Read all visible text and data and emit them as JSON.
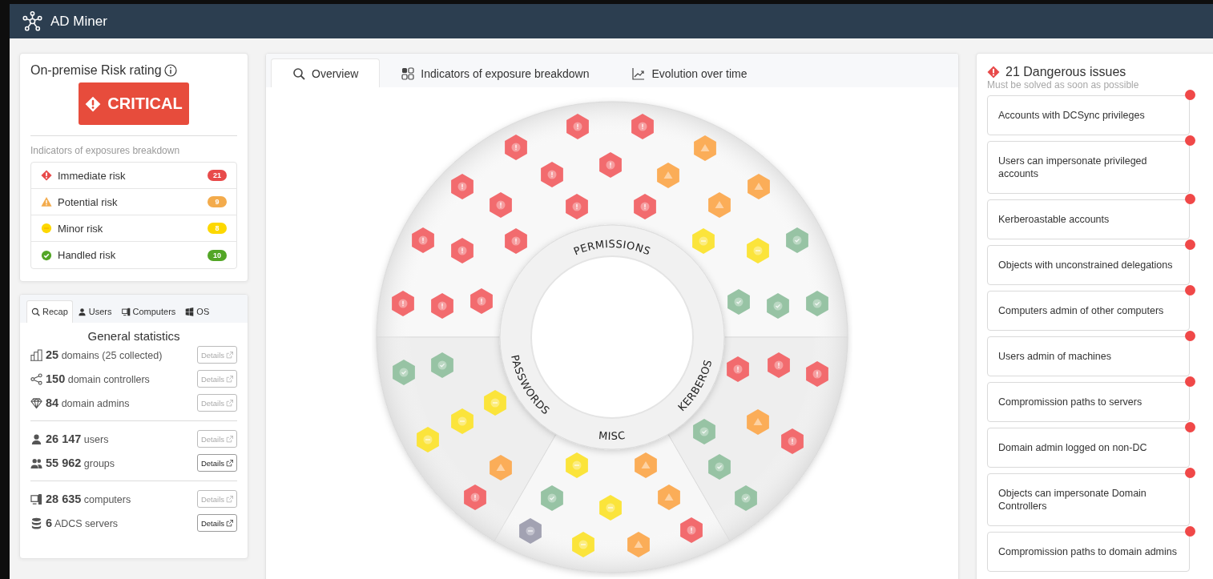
{
  "app": {
    "title": "AD Miner"
  },
  "risk_rating": {
    "title": "On-premise Risk rating",
    "rating": "CRITICAL"
  },
  "breakdown": {
    "title": "Indicators of exposures breakdown",
    "items": [
      {
        "kind": "immediate",
        "label": "Immediate risk",
        "count": "21",
        "color": "#e84a4a"
      },
      {
        "kind": "potential",
        "label": "Potential risk",
        "count": "9",
        "color": "#f3ab4c"
      },
      {
        "kind": "minor",
        "label": "Minor risk",
        "count": "8",
        "color": "#fdd800"
      },
      {
        "kind": "handled",
        "label": "Handled risk",
        "count": "10",
        "color": "#53a626"
      }
    ]
  },
  "stats_tabs": [
    {
      "kind": "search",
      "label": "Recap",
      "selected": true
    },
    {
      "kind": "user",
      "label": "Users",
      "selected": false
    },
    {
      "kind": "computer",
      "label": "Computers",
      "selected": false
    },
    {
      "kind": "windows",
      "label": "OS",
      "selected": false
    }
  ],
  "stats": {
    "title": "General statistics",
    "groups": [
      [
        {
          "kind": "building",
          "number": "25",
          "label": "domains (25 collected)",
          "details": {
            "label": "Details",
            "disabled": true
          }
        },
        {
          "kind": "share",
          "number": "150",
          "label": "domain controllers",
          "details": {
            "label": "Details",
            "disabled": true
          }
        },
        {
          "kind": "gem",
          "number": "84",
          "label": "domain admins",
          "details": {
            "label": "Details",
            "disabled": true
          }
        }
      ],
      [
        {
          "kind": "user",
          "number": "26 147",
          "label": "users",
          "details": {
            "label": "Details",
            "disabled": true
          }
        },
        {
          "kind": "users",
          "number": "55 962",
          "label": "groups",
          "details": {
            "label": "Details",
            "disabled": false
          }
        }
      ],
      [
        {
          "kind": "computer",
          "number": "28 635",
          "label": "computers",
          "details": {
            "label": "Details",
            "disabled": true
          }
        },
        {
          "kind": "database",
          "number": "6",
          "label": "ADCS servers",
          "details": {
            "label": "Details",
            "disabled": false
          }
        }
      ]
    ]
  },
  "main_tabs": [
    {
      "kind": "search",
      "label": "Overview",
      "selected": true
    },
    {
      "kind": "grid",
      "label": "Indicators of exposure breakdown",
      "selected": false
    },
    {
      "kind": "chart",
      "label": "Evolution over time",
      "selected": false
    }
  ],
  "diagram": {
    "sections": [
      {
        "label": "PERMISSIONS",
        "hexes": [
          {
            "kind": "immediate"
          },
          {
            "kind": "immediate"
          },
          {
            "kind": "immediate"
          },
          {
            "kind": "immediate"
          },
          {
            "kind": "immediate"
          },
          {
            "kind": "immediate"
          },
          {
            "kind": "immediate"
          },
          {
            "kind": "immediate"
          },
          {
            "kind": "immediate"
          },
          {
            "kind": "immediate"
          },
          {
            "kind": "immediate"
          },
          {
            "kind": "immediate"
          },
          {
            "kind": "immediate"
          },
          {
            "kind": "immediate"
          },
          {
            "kind": "immediate"
          },
          {
            "kind": "potential"
          },
          {
            "kind": "potential"
          },
          {
            "kind": "potential"
          },
          {
            "kind": "potential"
          },
          {
            "kind": "minor"
          },
          {
            "kind": "minor"
          },
          {
            "kind": "handled"
          },
          {
            "kind": "handled"
          },
          {
            "kind": "handled"
          },
          {
            "kind": "handled"
          }
        ]
      },
      {
        "label": "PASSWORDS",
        "hexes": [
          {
            "kind": "handled"
          },
          {
            "kind": "handled"
          },
          {
            "kind": "minor"
          },
          {
            "kind": "minor"
          },
          {
            "kind": "minor"
          },
          {
            "kind": "potential"
          },
          {
            "kind": "immediate"
          }
        ]
      },
      {
        "label": "MISC",
        "hexes": [
          {
            "kind": "minor"
          },
          {
            "kind": "potential"
          },
          {
            "kind": "handled"
          },
          {
            "kind": "minor"
          },
          {
            "kind": "potential"
          },
          {
            "kind": "none"
          },
          {
            "kind": "minor"
          },
          {
            "kind": "potential"
          },
          {
            "kind": "immediate"
          }
        ]
      },
      {
        "label": "KERBEROS",
        "hexes": [
          {
            "kind": "immediate"
          },
          {
            "kind": "immediate"
          },
          {
            "kind": "immediate"
          },
          {
            "kind": "potential"
          },
          {
            "kind": "handled"
          },
          {
            "kind": "immediate"
          },
          {
            "kind": "handled"
          },
          {
            "kind": "handled"
          }
        ]
      }
    ]
  },
  "issues": {
    "title": "21 Dangerous issues",
    "subtitle": "Must be solved as soon as possible",
    "items": [
      {
        "label": "Accounts with DCSync privileges"
      },
      {
        "label": "Users can impersonate privileged accounts"
      },
      {
        "label": "Kerberoastable accounts"
      },
      {
        "label": "Objects with unconstrained delegations"
      },
      {
        "label": "Computers admin of other computers"
      },
      {
        "label": "Users admin of machines"
      },
      {
        "label": "Compromission paths to servers"
      },
      {
        "label": "Domain admin logged on non-DC"
      },
      {
        "label": "Objects can impersonate Domain Controllers"
      },
      {
        "label": "Compromission paths to domain admins"
      }
    ]
  }
}
